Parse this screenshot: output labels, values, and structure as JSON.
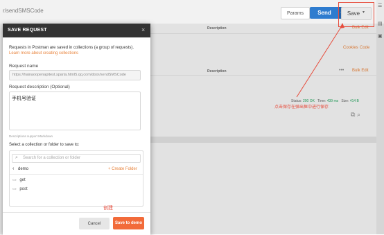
{
  "background": {
    "url_tail": "r/sendSMSCode",
    "params_label": "Params",
    "send_label": "Send",
    "save_label": "Save",
    "description_header": "Description",
    "bulk_edit_label": "Bulk Edit",
    "cookies_label": "Cookies",
    "code_label": "Code",
    "dots": "•••",
    "status": {
      "status_label": "Status:",
      "status_value": "200 OK",
      "time_label": "Time:",
      "time_value": "439 ms",
      "size_label": "Size:",
      "size_value": "414 B"
    }
  },
  "modal": {
    "title": "SAVE REQUEST",
    "intro_text": "Requests in Postman are saved in collections (a group of requests).",
    "learn_more_link": "Learn more about creating collections",
    "request_name_label": "Request name",
    "request_name_value": "https://hainaoopenapitest.sparta.html5.qq.com/door/sendSMSCode",
    "description_label": "Request description (Optional)",
    "description_value": "手机号验证",
    "markdown_hint": "Descriptions support Markdown",
    "collection_label": "Select a collection or folder to save to:",
    "search_placeholder": "Search for a collection or folder",
    "current_collection": "demo",
    "create_folder_label": "+ Create Folder",
    "folders": [
      {
        "name": "get"
      },
      {
        "name": "post"
      }
    ],
    "cancel_label": "Cancel",
    "save_to_label": "Save to demo"
  },
  "annotations": {
    "top_note": "点击保存在弹出框中进行保存",
    "create_note": "创建"
  },
  "colors": {
    "accent": "#f26b3a",
    "send_blue": "#2e7ccf",
    "annotation_red": "#e74c3c",
    "status_green": "#25a55f"
  }
}
